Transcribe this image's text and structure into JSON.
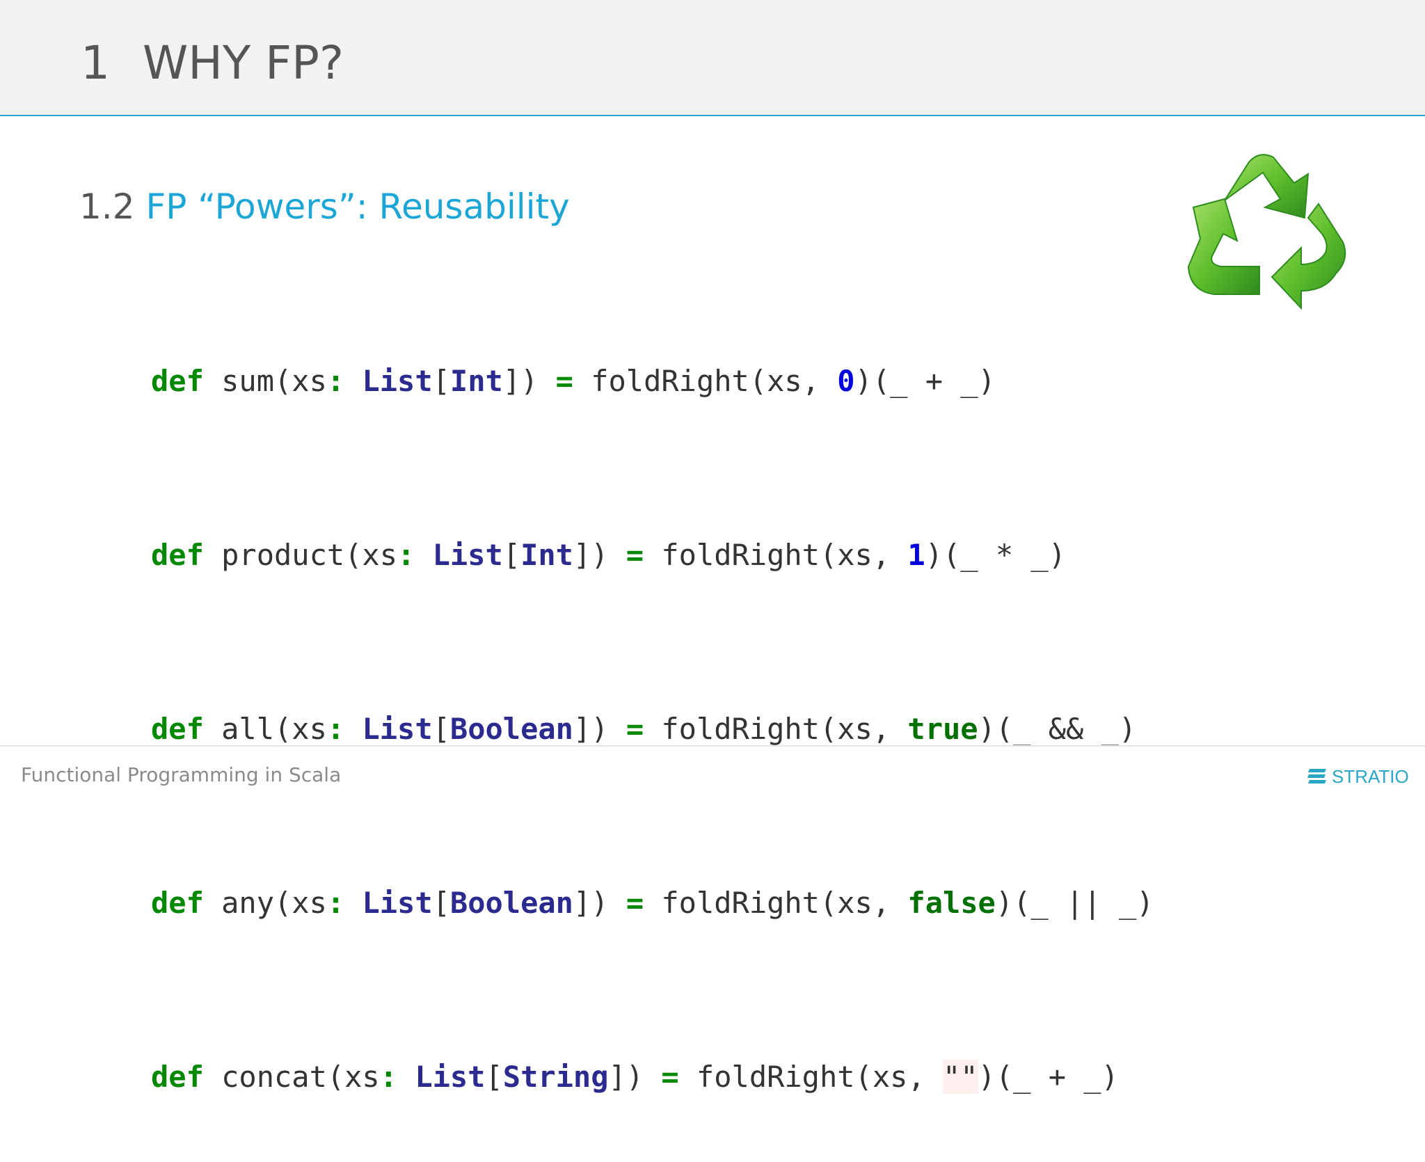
{
  "header": {
    "section_number": "1",
    "title": "WHY FP?"
  },
  "subtitle": {
    "number": "1.2",
    "title": "FP “Powers”: Reusability"
  },
  "code": {
    "line1": {
      "kw": "def",
      "name": " sum(xs",
      "colon": ":",
      "sp": " ",
      "list": "List",
      "lb": "[",
      "type": "Int",
      "rb": "]",
      "rest1": ") ",
      "eq": "=",
      "rest2": " foldRight(xs, ",
      "init": "0",
      "rest3": ")(_ + _)"
    },
    "line2": {
      "kw": "def",
      "name": " product(xs",
      "colon": ":",
      "sp": " ",
      "list": "List",
      "lb": "[",
      "type": "Int",
      "rb": "]",
      "rest1": ") ",
      "eq": "=",
      "rest2": " foldRight(xs, ",
      "init": "1",
      "rest3": ")(_ * _)"
    },
    "line3": {
      "kw": "def",
      "name": " all(xs",
      "colon": ":",
      "sp": " ",
      "list": "List",
      "lb": "[",
      "type": "Boolean",
      "rb": "]",
      "rest1": ") ",
      "eq": "=",
      "rest2": " foldRight(xs, ",
      "init": "true",
      "rest3": ")(_ && _)"
    },
    "line4": {
      "kw": "def",
      "name": " any(xs",
      "colon": ":",
      "sp": " ",
      "list": "List",
      "lb": "[",
      "type": "Boolean",
      "rb": "]",
      "rest1": ") ",
      "eq": "=",
      "rest2": " foldRight(xs, ",
      "init": "false",
      "rest3": ")(_ || _)"
    },
    "line5": {
      "kw": "def",
      "name": " concat(xs",
      "colon": ":",
      "sp": " ",
      "list": "List",
      "lb": "[",
      "type": "String",
      "rb": "]",
      "rest1": ") ",
      "eq": "=",
      "rest2": " foldRight(xs, ",
      "init": "\"\"",
      "rest3": ")(_ + _)"
    }
  },
  "image": {
    "icon": "recycle-icon",
    "colors": [
      "#2e8b1e",
      "#6cc83a",
      "#a8e06a"
    ]
  },
  "footer": {
    "text": "Functional Programming in Scala",
    "logo_text": "STRATIO",
    "logo_color": "#2aa6c9"
  }
}
